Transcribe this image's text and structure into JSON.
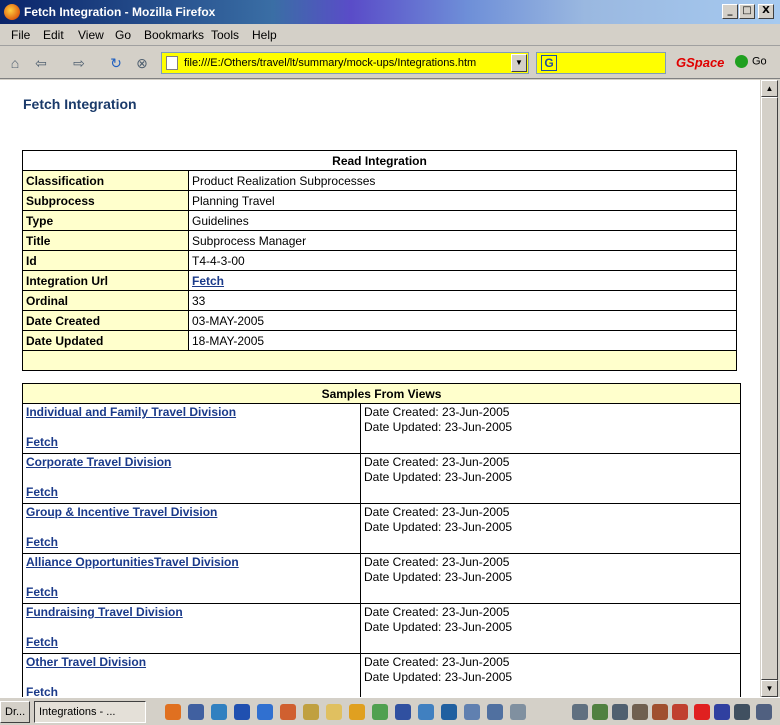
{
  "window": {
    "title": "Fetch Integration - Mozilla Firefox",
    "minimize": "_",
    "maximize": "□",
    "close": "X"
  },
  "menu": [
    "File",
    "Edit",
    "View",
    "Go",
    "Bookmarks",
    "Tools",
    "Help"
  ],
  "nav": {
    "url": "file:///E:/Others/travel/lt/summary/mock-ups/Integrations.htm",
    "gspace": "GSpace",
    "go": "Go"
  },
  "page": {
    "heading": "Fetch Integration",
    "read": {
      "title": "Read Integration",
      "rows": [
        {
          "k": "Classification",
          "v": "Product Realization Subprocesses"
        },
        {
          "k": "Subprocess",
          "v": "Planning Travel"
        },
        {
          "k": "Type",
          "v": "Guidelines"
        },
        {
          "k": "Title",
          "v": "Subprocess Manager"
        },
        {
          "k": "Id",
          "v": "T4-4-3-00"
        },
        {
          "k": "Integration Url",
          "v": "Fetch",
          "link": true
        },
        {
          "k": "Ordinal",
          "v": "33"
        },
        {
          "k": "Date Created",
          "v": "03-MAY-2005"
        },
        {
          "k": "Date Updated",
          "v": "18-MAY-2005"
        }
      ]
    },
    "samples": {
      "title": "Samples From Views",
      "fetch": "Fetch",
      "rows": [
        {
          "name": "Individual and Family Travel Division",
          "created": "Date Created: 23-Jun-2005",
          "updated": "Date Updated: 23-Jun-2005"
        },
        {
          "name": "Corporate Travel Division",
          "created": "Date Created: 23-Jun-2005",
          "updated": "Date Updated: 23-Jun-2005"
        },
        {
          "name": "Group & Incentive Travel Division",
          "created": "Date Created: 23-Jun-2005",
          "updated": "Date Updated: 23-Jun-2005"
        },
        {
          "name": "Alliance OpportunitiesTravel Division",
          "created": "Date Created: 23-Jun-2005",
          "updated": "Date Updated: 23-Jun-2005"
        },
        {
          "name": "Fundraising Travel Division",
          "created": "Date Created: 23-Jun-2005",
          "updated": "Date Updated: 23-Jun-2005"
        },
        {
          "name": "Other Travel Division",
          "created": "Date Created: 23-Jun-2005",
          "updated": "Date Updated: 23-Jun-2005"
        }
      ]
    }
  },
  "taskbar": {
    "item1": "Dr...",
    "item2": "Integrations - ..."
  }
}
